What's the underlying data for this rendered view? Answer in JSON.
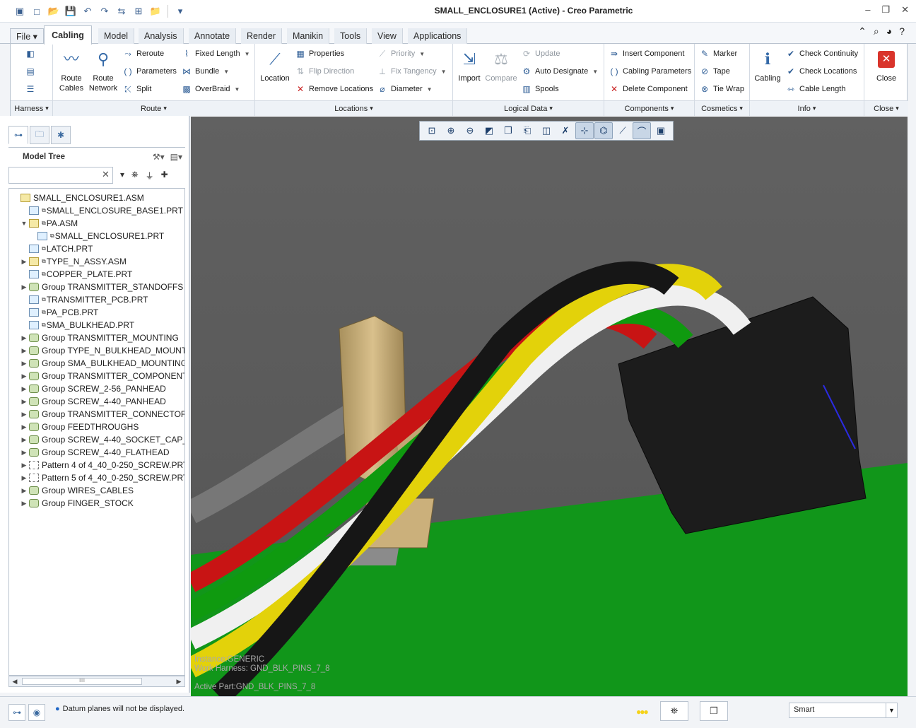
{
  "window": {
    "title": "SMALL_ENCLOSURE1 (Active) - Creo Parametric",
    "min": "–",
    "restore": "❐",
    "close": "✕"
  },
  "qat": [
    "▣",
    "□",
    "📂",
    "💾",
    "↶",
    "↷",
    "⇆",
    "⊞",
    "📁",
    "▾"
  ],
  "tabs": {
    "file": "File ▾",
    "cabling": "Cabling",
    "model": "Model",
    "analysis": "Analysis",
    "annotate": "Annotate",
    "render": "Render",
    "manikin": "Manikin",
    "tools": "Tools",
    "view": "View",
    "applications": "Applications"
  },
  "ribbon": {
    "harness": {
      "label": "Harness"
    },
    "route": {
      "label": "Route",
      "route_cables": "Route\nCables",
      "route_network": "Route\nNetwork",
      "reroute": "Reroute",
      "parameters": "Parameters",
      "split": "Split",
      "fixed_length": "Fixed Length",
      "bundle": "Bundle",
      "overbraid": "OverBraid"
    },
    "locations": {
      "label": "Locations",
      "location": "Location",
      "properties": "Properties",
      "flip_direction": "Flip Direction",
      "remove_locations": "Remove Locations",
      "priority": "Priority",
      "fix_tangency": "Fix Tangency",
      "diameter": "Diameter"
    },
    "logical": {
      "label": "Logical Data",
      "import": "Import",
      "compare": "Compare",
      "update": "Update",
      "auto_designate": "Auto Designate",
      "spools": "Spools"
    },
    "components": {
      "label": "Components",
      "insert": "Insert Component",
      "cabling_parameters": "Cabling Parameters",
      "delete": "Delete Component"
    },
    "cosmetics": {
      "label": "Cosmetics",
      "marker": "Marker",
      "tape": "Tape",
      "tie_wrap": "Tie Wrap"
    },
    "info": {
      "label": "Info",
      "cabling": "Cabling",
      "check_continuity": "Check Continuity",
      "check_locations": "Check Locations",
      "cable_length": "Cable Length"
    },
    "close": {
      "label": "Close",
      "button": "Close"
    }
  },
  "model_tree": {
    "title": "Model Tree",
    "search_value": "",
    "items": [
      {
        "label": "SMALL_ENCLOSURE1.ASM",
        "type": "asm",
        "indent": 0,
        "exp": ""
      },
      {
        "label": "SMALL_ENCLOSURE_BASE1.PRT",
        "type": "prt",
        "indent": 1,
        "exp": "",
        "sub": true
      },
      {
        "label": "PA.ASM",
        "type": "asm",
        "indent": 1,
        "exp": "▼",
        "sub": true
      },
      {
        "label": "SMALL_ENCLOSURE1.PRT",
        "type": "prt",
        "indent": 2,
        "exp": "",
        "sub": true
      },
      {
        "label": "LATCH.PRT",
        "type": "prt",
        "indent": 1,
        "exp": "",
        "sub": true
      },
      {
        "label": "TYPE_N_ASSY.ASM",
        "type": "asm",
        "indent": 1,
        "exp": "▶",
        "sub": true
      },
      {
        "label": "COPPER_PLATE.PRT",
        "type": "prt",
        "indent": 1,
        "exp": "",
        "sub": true
      },
      {
        "label": "Group TRANSMITTER_STANDOFFS",
        "type": "grp",
        "indent": 1,
        "exp": "▶"
      },
      {
        "label": "TRANSMITTER_PCB.PRT",
        "type": "prt",
        "indent": 1,
        "exp": "",
        "sub": true
      },
      {
        "label": "PA_PCB.PRT",
        "type": "prt",
        "indent": 1,
        "exp": "",
        "sub": true
      },
      {
        "label": "SMA_BULKHEAD.PRT",
        "type": "prt",
        "indent": 1,
        "exp": "",
        "sub": true
      },
      {
        "label": "Group TRANSMITTER_MOUNTING",
        "type": "grp",
        "indent": 1,
        "exp": "▶"
      },
      {
        "label": "Group TYPE_N_BULKHEAD_MOUNT",
        "type": "grp",
        "indent": 1,
        "exp": "▶"
      },
      {
        "label": "Group SMA_BULKHEAD_MOUNTING",
        "type": "grp",
        "indent": 1,
        "exp": "▶"
      },
      {
        "label": "Group TRANSMITTER_COMPONENT",
        "type": "grp",
        "indent": 1,
        "exp": "▶"
      },
      {
        "label": "Group SCREW_2-56_PANHEAD",
        "type": "grp",
        "indent": 1,
        "exp": "▶"
      },
      {
        "label": "Group SCREW_4-40_PANHEAD",
        "type": "grp",
        "indent": 1,
        "exp": "▶"
      },
      {
        "label": "Group TRANSMITTER_CONNECTOR",
        "type": "grp",
        "indent": 1,
        "exp": "▶"
      },
      {
        "label": "Group FEEDTHROUGHS",
        "type": "grp",
        "indent": 1,
        "exp": "▶"
      },
      {
        "label": "Group SCREW_4-40_SOCKET_CAP_",
        "type": "grp",
        "indent": 1,
        "exp": "▶"
      },
      {
        "label": "Group SCREW_4-40_FLATHEAD",
        "type": "grp",
        "indent": 1,
        "exp": "▶"
      },
      {
        "label": "Pattern 4 of 4_40_0-250_SCREW.PRT",
        "type": "pat",
        "indent": 1,
        "exp": "▶"
      },
      {
        "label": "Pattern 5 of 4_40_0-250_SCREW.PRT",
        "type": "pat",
        "indent": 1,
        "exp": "▶"
      },
      {
        "label": "Group WIRES_CABLES",
        "type": "grp",
        "indent": 1,
        "exp": "▶"
      },
      {
        "label": "Group FINGER_STOCK",
        "type": "grp",
        "indent": 1,
        "exp": "▶"
      }
    ],
    "scroll_thumb": "IIII"
  },
  "viewport": {
    "instance": "Instance:GENERIC",
    "harness": "Work Harness: GND_BLK_PINS_7_8",
    "active_part": "Active Part:GND_BLK_PINS_7_8"
  },
  "status": {
    "message": "Datum planes will not be displayed.",
    "filter": "Smart"
  },
  "colors": {
    "accent": "#356aa8",
    "board": "#129a12",
    "connector": "#1b1b1b",
    "brass": "#cbb07b",
    "wire_red": "#c91414",
    "wire_green": "#0f9a0f",
    "wire_yellow": "#e3d20a",
    "wire_white": "#f2f2f2",
    "wire_black": "#161616",
    "wire_gray": "#7d7d7d"
  }
}
